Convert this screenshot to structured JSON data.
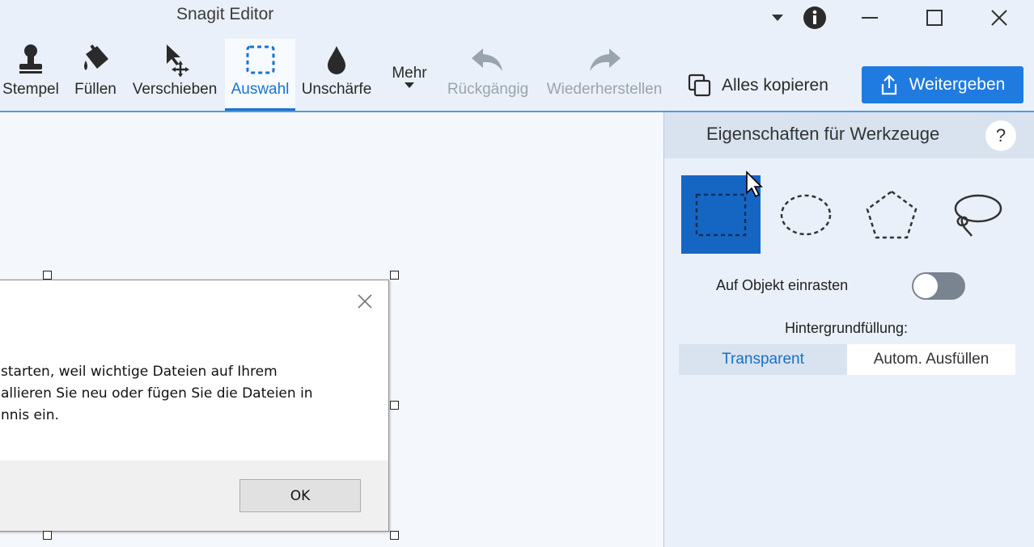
{
  "window": {
    "title": "Snagit Editor",
    "controls": [
      "dropdown-arrow",
      "info-icon",
      "minimize",
      "maximize",
      "close"
    ]
  },
  "toolbar": {
    "tools": [
      {
        "label": "Stempel",
        "icon": "stamp-icon"
      },
      {
        "label": "Füllen",
        "icon": "fill-bucket-icon"
      },
      {
        "label": "Verschieben",
        "icon": "move-icon"
      },
      {
        "label": "Auswahl",
        "icon": "selection-icon",
        "active": true
      },
      {
        "label": "Unschärfe",
        "icon": "blur-drop-icon"
      },
      {
        "label": "Mehr",
        "icon": "chevron-down-icon"
      },
      {
        "label": "Rückgängig",
        "icon": "undo-icon",
        "disabled": true
      },
      {
        "label": "Wiederherstellen",
        "icon": "redo-icon",
        "disabled": true
      }
    ],
    "copy_all_label": "Alles kopieren",
    "share_label": "Weitergeben"
  },
  "canvas": {
    "dialog": {
      "message_lines": [
        "starten, weil wichtige Dateien auf Ihrem",
        "allieren Sie neu oder fügen Sie die Dateien in",
        "nnis ein."
      ],
      "ok_label": "OK"
    }
  },
  "panel": {
    "title": "Eigenschaften für Werkzeuge",
    "help_label": "?",
    "shapes": [
      {
        "name": "rectangle-selection",
        "selected": true
      },
      {
        "name": "ellipse-selection"
      },
      {
        "name": "polygon-selection"
      },
      {
        "name": "freehand-selection"
      }
    ],
    "snap_label": "Auf Objekt einrasten",
    "snap_enabled": false,
    "bg_fill_label": "Hintergrundfüllung:",
    "bg_options": [
      "Transparent",
      "Autom. Ausfüllen"
    ],
    "bg_selected": "Transparent"
  },
  "colors": {
    "accent": "#1f7be0",
    "selected_shape": "#1566c3",
    "toolbar_bg": "#e9f0f9",
    "panel_header_bg": "#d8e3ef"
  }
}
